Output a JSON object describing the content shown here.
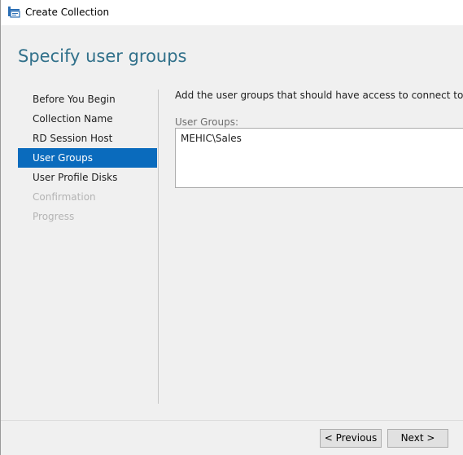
{
  "window": {
    "title": "Create Collection",
    "app_icon": "server-manager-icon"
  },
  "page": {
    "title": "Specify user groups"
  },
  "nav": {
    "items": [
      {
        "label": "Before You Begin",
        "state": "normal"
      },
      {
        "label": "Collection Name",
        "state": "normal"
      },
      {
        "label": "RD Session Host",
        "state": "normal"
      },
      {
        "label": "User Groups",
        "state": "active"
      },
      {
        "label": "User Profile Disks",
        "state": "normal"
      },
      {
        "label": "Confirmation",
        "state": "disabled"
      },
      {
        "label": "Progress",
        "state": "disabled"
      }
    ]
  },
  "content": {
    "instruction": "Add the user groups that should have access to connect to the colle",
    "user_groups_label": "User Groups:",
    "user_groups": [
      "MEHIC\\Sales"
    ]
  },
  "footer": {
    "previous_label": "< Previous",
    "next_label": "Next >"
  },
  "colors": {
    "accent": "#0a6bbd",
    "title": "#30708a",
    "disabled": "#b4b4b4"
  }
}
